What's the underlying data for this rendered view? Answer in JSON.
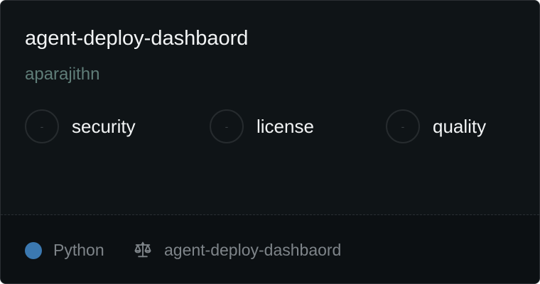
{
  "card": {
    "repo_name": "agent-deploy-dashbaord",
    "owner": "aparajithn"
  },
  "metrics": [
    {
      "label": "security",
      "value": "-"
    },
    {
      "label": "license",
      "value": "-"
    },
    {
      "label": "quality",
      "value": "-"
    }
  ],
  "footer": {
    "language": "Python",
    "language_color": "#3b78b0",
    "license_icon": "scale-icon",
    "license_text": "agent-deploy-dashbaord"
  }
}
